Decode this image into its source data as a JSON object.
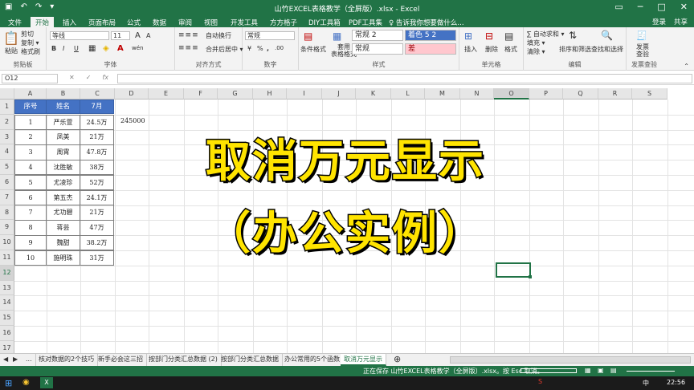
{
  "title_bar": {
    "title": "山竹EXCEL表格教学（全屏版）.xlsx - Excel",
    "quick_access": [
      "↶",
      "↷",
      "▾"
    ]
  },
  "tabs": [
    "文件",
    "开始",
    "插入",
    "页面布局",
    "公式",
    "数据",
    "审阅",
    "视图",
    "开发工具",
    "方方格子",
    "DIY工具箱",
    "PDF工具集"
  ],
  "tell_me": "♀ 告诉我你想要做什么...",
  "account": {
    "login": "登录",
    "share": "共享"
  },
  "ribbon": {
    "clipboard": {
      "paste": "粘贴",
      "cut": "剪切",
      "copy": "复制 ▾",
      "format_painter": "格式刷",
      "label": "剪贴板"
    },
    "font": {
      "name": "等线",
      "size": "11",
      "grow": "A",
      "shrink": "A",
      "bold": "B",
      "italic": "I",
      "underline": "U",
      "wen": "wén",
      "label": "字体"
    },
    "alignment": {
      "wrap": "自动换行",
      "merge": "合并后居中 ▾",
      "label": "对齐方式"
    },
    "number": {
      "format": "常规",
      "percent": "%",
      "comma": ",",
      "label": "数字"
    },
    "styles": {
      "conditional": "条件格式",
      "table": "套用\n表格格式",
      "normal2": "常规 2",
      "accent": "着色 5 2",
      "normal": "常规",
      "bad": "差",
      "label": "样式"
    },
    "cells": {
      "insert": "插入",
      "delete": "删除",
      "format": "格式",
      "label": "单元格"
    },
    "editing": {
      "autosum": "∑ 自动求和 ▾",
      "fill": "填充 ▾",
      "clear": "清除 ▾",
      "sort": "排序和筛选",
      "find": "查找和选择",
      "label": "编辑"
    },
    "invoice": {
      "check": "发票\n查验",
      "label": "发票查验"
    }
  },
  "formula_bar": {
    "name_box": "O12",
    "cancel": "✕",
    "enter": "✓",
    "fx": "fx",
    "value": ""
  },
  "columns": [
    "A",
    "B",
    "C",
    "D",
    "E",
    "F",
    "G",
    "H",
    "I",
    "J",
    "K",
    "L",
    "M",
    "N",
    "O",
    "P",
    "Q",
    "R",
    "S"
  ],
  "rows": [
    "1",
    "2",
    "3",
    "4",
    "5",
    "6",
    "7",
    "8",
    "9",
    "10",
    "11",
    "12",
    "13",
    "14",
    "15",
    "16",
    "17"
  ],
  "table": {
    "headers": [
      "序号",
      "姓名",
      "7月"
    ],
    "rows": [
      [
        "1",
        "严乐萱",
        "24.5万"
      ],
      [
        "2",
        "凤美",
        "21万"
      ],
      [
        "3",
        "周霄",
        "47.8万"
      ],
      [
        "4",
        "沈胜敏",
        "38万"
      ],
      [
        "5",
        "尤凌珍",
        "52万"
      ],
      [
        "6",
        "第五杰",
        "24.1万"
      ],
      [
        "7",
        "尤功碧",
        "21万"
      ],
      [
        "8",
        "蒋芸",
        "47万"
      ],
      [
        "9",
        "魏甜",
        "38.2万"
      ],
      [
        "10",
        "施明珠",
        "31万"
      ]
    ]
  },
  "d2_value": "245000",
  "overlay": {
    "line1": "取消万元显示",
    "line2": "（办公实例）"
  },
  "sheet_tabs": [
    "...",
    "核对数据的2个技巧",
    "新手必会这三招",
    "按部门分类汇总数据 (2)",
    "按部门分类汇总数据",
    "办公常用的5个函数",
    "取消万元显示"
  ],
  "active_sheet": "取消万元显示",
  "status": "正在保存 山竹EXCEL表格教学（全屏版）.xlsx。按 Esc 取消。",
  "taskbar": {
    "lang": "中",
    "time": "22:56"
  }
}
